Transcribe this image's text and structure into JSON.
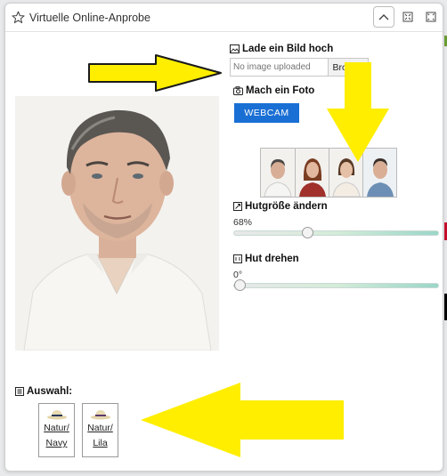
{
  "window": {
    "title": "Virtuelle Online-Anprobe"
  },
  "upload": {
    "label": "Lade ein Bild hoch",
    "placeholder": "No image uploaded",
    "browse_label": "Browse"
  },
  "photo": {
    "label": "Mach ein Foto",
    "webcam_label": "WEBCAM"
  },
  "sample_faces": [
    "man-portrait-1",
    "woman-portrait-1",
    "woman-portrait-2",
    "man-portrait-2"
  ],
  "hat_size": {
    "label": "Hutgröße ändern",
    "value": "68%",
    "fraction": 0.35
  },
  "hat_rotate": {
    "label": "Hut drehen",
    "value": "0°",
    "fraction": 0.0
  },
  "selection": {
    "label": "Auswahl:",
    "hats": [
      {
        "line1": "Natur/",
        "line2": "Navy",
        "band_color": "#2b3a5a"
      },
      {
        "line1": "Natur/",
        "line2": "Lila",
        "band_color": "#5b3b6e"
      }
    ]
  },
  "colors": {
    "accent": "#1a6fd4",
    "annotation_arrow": "#ffee00"
  }
}
